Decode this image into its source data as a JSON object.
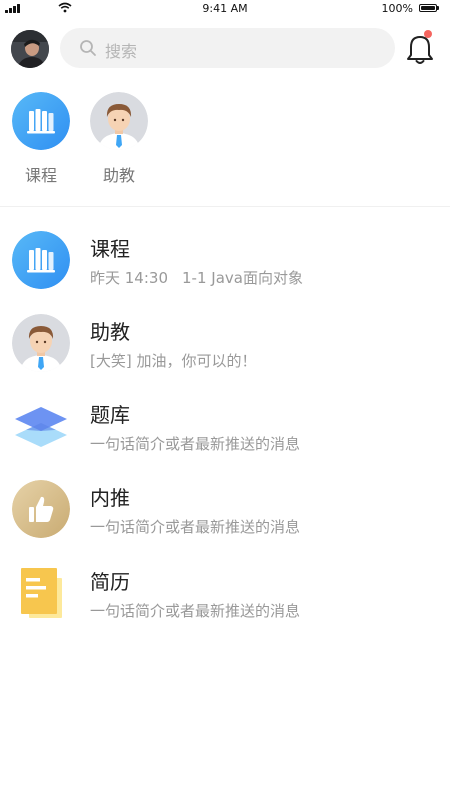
{
  "status_bar": {
    "time": "9:41 AM",
    "battery": "100%",
    "battery_level": 1.0,
    "icons": [
      "signal-icon",
      "wifi-icon",
      "battery-icon"
    ]
  },
  "header": {
    "avatar": "user-avatar",
    "search_placeholder": "搜索",
    "search_icon": "search-icon",
    "bell_icon": "bell-icon",
    "has_notification": true
  },
  "quick_entries": [
    {
      "label": "课程",
      "icon": "books-icon"
    },
    {
      "label": "助教",
      "icon": "assistant-avatar-icon"
    }
  ],
  "messages": [
    {
      "title": "课程",
      "time": "昨天 14:30",
      "subtitle": "1-1 Java面向对象",
      "icon": "books-icon"
    },
    {
      "title": "助教",
      "subtitle": "[大笑] 加油，你可以的！",
      "icon": "assistant-avatar-icon"
    },
    {
      "title": "题库",
      "subtitle": "一句话简介或者最新推送的消息",
      "icon": "layers-icon"
    },
    {
      "title": "内推",
      "subtitle": "一句话简介或者最新推送的消息",
      "icon": "thumbs-up-icon"
    },
    {
      "title": "简历",
      "subtitle": "一句话简介或者最新推送的消息",
      "icon": "document-icon"
    }
  ],
  "colors": {
    "accent_blue": "#3fa6f5",
    "notification_red": "#f5655f",
    "layers_blue": "#6d93f2",
    "thumb_gold": "#d6bd8c",
    "doc_yellow": "#f7c64e"
  }
}
